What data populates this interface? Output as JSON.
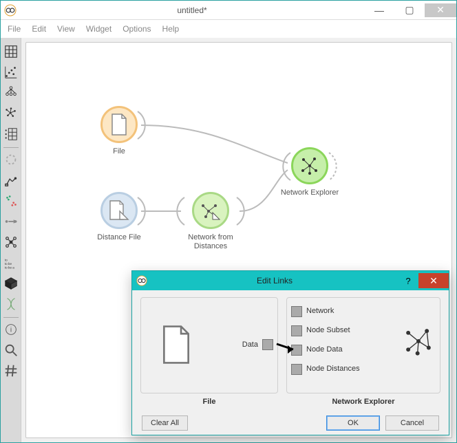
{
  "window": {
    "title": "untitled*",
    "menus": [
      "File",
      "Edit",
      "View",
      "Widget",
      "Options",
      "Help"
    ],
    "win_buttons": {
      "min": "—",
      "max": "▢",
      "close": "✕"
    }
  },
  "toolbox": {
    "items": [
      "grid-icon",
      "scatter-icon",
      "tree-icon",
      "network-icon",
      "pivot-icon",
      "ring-icon",
      "digger-icon",
      "cluster-scatter-icon",
      "map-icon",
      "butterfly-icon",
      "words-icon",
      "cube-icon",
      "dna-icon",
      "info-icon",
      "search-icon",
      "hash-icon"
    ]
  },
  "canvas": {
    "nodes": {
      "file": {
        "label": "File"
      },
      "distfile": {
        "label": "Distance File"
      },
      "netdist": {
        "label": "Network from Distances"
      },
      "netexp": {
        "label": "Network Explorer"
      }
    }
  },
  "dialog": {
    "title": "Edit Links",
    "help": "?",
    "close": "✕",
    "left": {
      "label": "File",
      "outputs": [
        "Data"
      ]
    },
    "right": {
      "label": "Network Explorer",
      "inputs": [
        "Network",
        "Node Subset",
        "Node Data",
        "Node Distances"
      ]
    },
    "connections": [
      {
        "from": "Data",
        "to": "Node Data"
      }
    ],
    "buttons": {
      "clear": "Clear All",
      "ok": "OK",
      "cancel": "Cancel"
    }
  }
}
